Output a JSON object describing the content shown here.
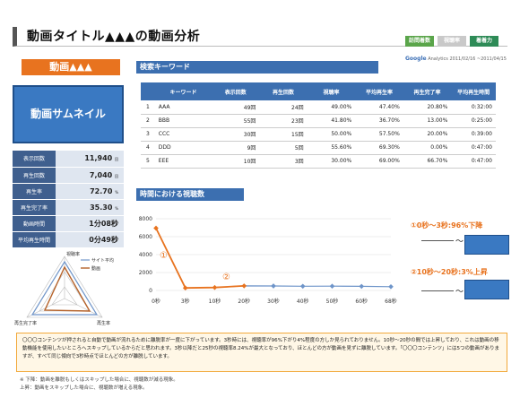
{
  "header": {
    "title": "動画タイトル▲▲▲の動画分析",
    "tags": [
      {
        "label": "訪問着数",
        "color": "#5aa54a"
      },
      {
        "label": "視聴率",
        "color": "#c9c9c9"
      },
      {
        "label": "着着力",
        "color": "#2e8b57"
      }
    ],
    "ga_brand": "Google",
    "ga_sub": "Analytics",
    "date_range": "2011/02/16 ~2011/04/15"
  },
  "left": {
    "video_name": "動画▲▲▲",
    "thumbnail_label": "動画サムネイル",
    "stats": [
      {
        "label": "表示回数",
        "value": "11,940",
        "unit": "回"
      },
      {
        "label": "再生回数",
        "value": "7,040",
        "unit": "回"
      },
      {
        "label": "再生率",
        "value": "72.70",
        "unit": "%"
      },
      {
        "label": "再生完了率",
        "value": "35.30",
        "unit": "%"
      },
      {
        "label": "動画時間",
        "value": "1分08秒",
        "unit": ""
      },
      {
        "label": "平均再生時間",
        "value": "0分49秒",
        "unit": ""
      }
    ]
  },
  "radar": {
    "legend": [
      "サイト平均",
      "動画"
    ],
    "axes": [
      "視聴率",
      "再生率",
      "再生完了率"
    ]
  },
  "keywords": {
    "section_title": "検索キーワード",
    "columns": [
      "",
      "キーワード",
      "表示回数",
      "再生回数",
      "視聴率",
      "平均再生率",
      "再生完了率",
      "平均再生時間"
    ],
    "rows": [
      [
        "1",
        "AAA",
        "49回",
        "24回",
        "49.00%",
        "47.40%",
        "20.80%",
        "0:32:00"
      ],
      [
        "2",
        "BBB",
        "55回",
        "23回",
        "41.80%",
        "36.70%",
        "13.00%",
        "0:25:00"
      ],
      [
        "3",
        "CCC",
        "30回",
        "15回",
        "50.00%",
        "57.50%",
        "20.00%",
        "0:39:00"
      ],
      [
        "4",
        "DDD",
        "9回",
        "5回",
        "55.60%",
        "69.30%",
        "0.00%",
        "0:47:00"
      ],
      [
        "5",
        "EEE",
        "10回",
        "3回",
        "30.00%",
        "69.00%",
        "66.70%",
        "0:47:00"
      ]
    ]
  },
  "chart_section": {
    "title": "時間における視聴数",
    "markers": [
      "①",
      "②"
    ],
    "annotations": [
      {
        "text": "①0秒～3秒:96%下降",
        "tilde": "～"
      },
      {
        "text": "②10秒～20秒:3%上昇",
        "tilde": "～"
      }
    ]
  },
  "chart_data": {
    "type": "line",
    "categories": [
      "0秒",
      "3秒",
      "10秒",
      "20秒",
      "30秒",
      "40秒",
      "50秒",
      "60秒",
      "68秒"
    ],
    "values": [
      6950,
      280,
      330,
      510,
      500,
      470,
      480,
      460,
      420
    ],
    "highlight_values": [
      6950,
      280,
      330,
      510
    ],
    "ylim": [
      0,
      8000
    ],
    "yticks": [
      0,
      2000,
      4000,
      6000,
      8000
    ],
    "grid": true,
    "colors": {
      "line": "#6f95c9",
      "highlight": "#e8731f"
    }
  },
  "notes": {
    "paragraph": "〇〇〇コンテンツが押されると自動で動画が流れるために離脱率が一度に下がっています。3秒時には、視聴率が96%下がり4%程度の方しか見られておりません。10秒～20秒の間では上昇しており、これは動画の移動機能を使用したいところへスキップしているからだと思われます。3秒以降だと25秒の視聴率8.24%が最大となっており、ほとんどの方が動画を見ずに離脱しています。「〇〇〇コンテンツ」には5つの動画がありますが、すべて同じ傾向で3秒時点でほとんどの方が離脱しています。",
    "footnotes": [
      "※  下降：動画を離脱もしくはスキップした場合に、視聴数が減る現象。",
      "     上昇：動画をスキップした場合に、視聴数が増える現象。"
    ]
  }
}
